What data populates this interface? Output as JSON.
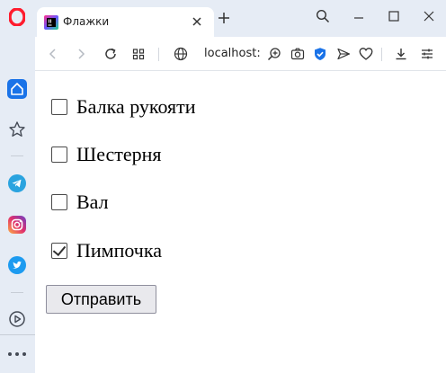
{
  "browser": {
    "tab_title": "Флажки",
    "url": "localhost:",
    "accent_color": "#1a73e8",
    "sidebar_icons": [
      "opera-logo-icon",
      "home-icon",
      "star-icon",
      "telegram-icon",
      "instagram-icon",
      "twitter-icon",
      "play-icon",
      "more-icon"
    ],
    "toolbar_icons": [
      "back-icon",
      "forward-icon",
      "reload-icon",
      "tabs-grid-icon",
      "globe-icon",
      "zoom-icon",
      "camera-icon",
      "shield-icon",
      "send-icon",
      "heart-icon",
      "download-icon",
      "settings-icon"
    ]
  },
  "form": {
    "checkboxes": [
      {
        "label": "Балка рукояти",
        "checked": false
      },
      {
        "label": "Шестерня",
        "checked": false
      },
      {
        "label": "Вал",
        "checked": false
      },
      {
        "label": "Пимпочка",
        "checked": true
      }
    ],
    "submit_label": "Отправить"
  }
}
